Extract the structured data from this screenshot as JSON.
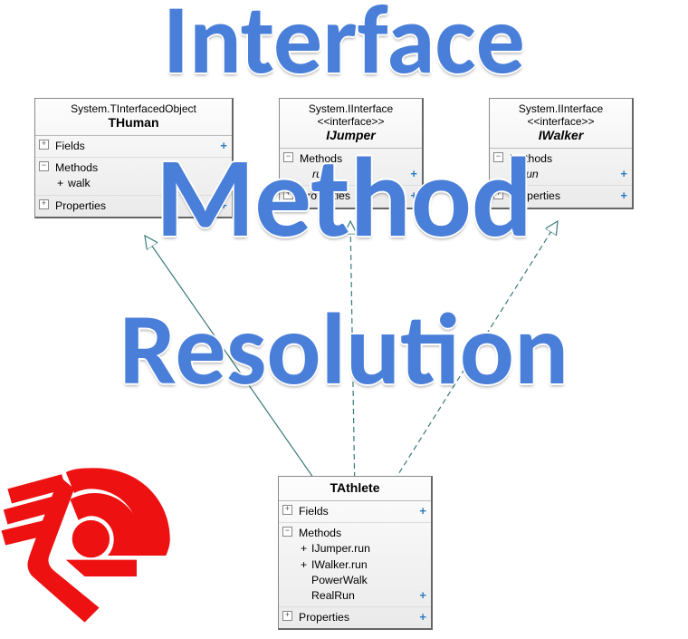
{
  "title": {
    "line1": "Interface",
    "line2": "Method",
    "line3": "Resolution"
  },
  "classes": {
    "thuman": {
      "parent": "System.TInterfacedObject",
      "name": "THuman",
      "sections": {
        "fields": {
          "label": "Fields",
          "expanded": false
        },
        "methods": {
          "label": "Methods",
          "expanded": true,
          "members": [
            {
              "sym": "+",
              "text": "walk"
            }
          ]
        },
        "properties": {
          "label": "Properties",
          "expanded": false
        }
      }
    },
    "ijumper": {
      "parent": "System.IInterface",
      "stereo": "<<interface>>",
      "name": "IJumper",
      "sections": {
        "methods": {
          "label": "Methods",
          "expanded": true,
          "members": [
            {
              "sym": "",
              "text": "run",
              "iface": true
            }
          ]
        },
        "properties": {
          "label": "Properties",
          "expanded": false
        }
      }
    },
    "iwalker": {
      "parent": "System.IInterface",
      "stereo": "<<interface>>",
      "name": "IWalker",
      "sections": {
        "methods": {
          "label": "Methods",
          "expanded": true,
          "members": [
            {
              "sym": "",
              "text": "run",
              "iface": true
            }
          ]
        },
        "properties": {
          "label": "Properties",
          "expanded": false
        }
      }
    },
    "tathlete": {
      "name": "TAthlete",
      "sections": {
        "fields": {
          "label": "Fields",
          "expanded": false
        },
        "methods": {
          "label": "Methods",
          "expanded": true,
          "members": [
            {
              "sym": "+",
              "text": "IJumper.run"
            },
            {
              "sym": "+",
              "text": "IWalker.run"
            },
            {
              "sym": "",
              "text": "PowerWalk"
            },
            {
              "sym": "",
              "text": "RealRun"
            }
          ]
        },
        "properties": {
          "label": "Properties",
          "expanded": false
        }
      }
    }
  }
}
